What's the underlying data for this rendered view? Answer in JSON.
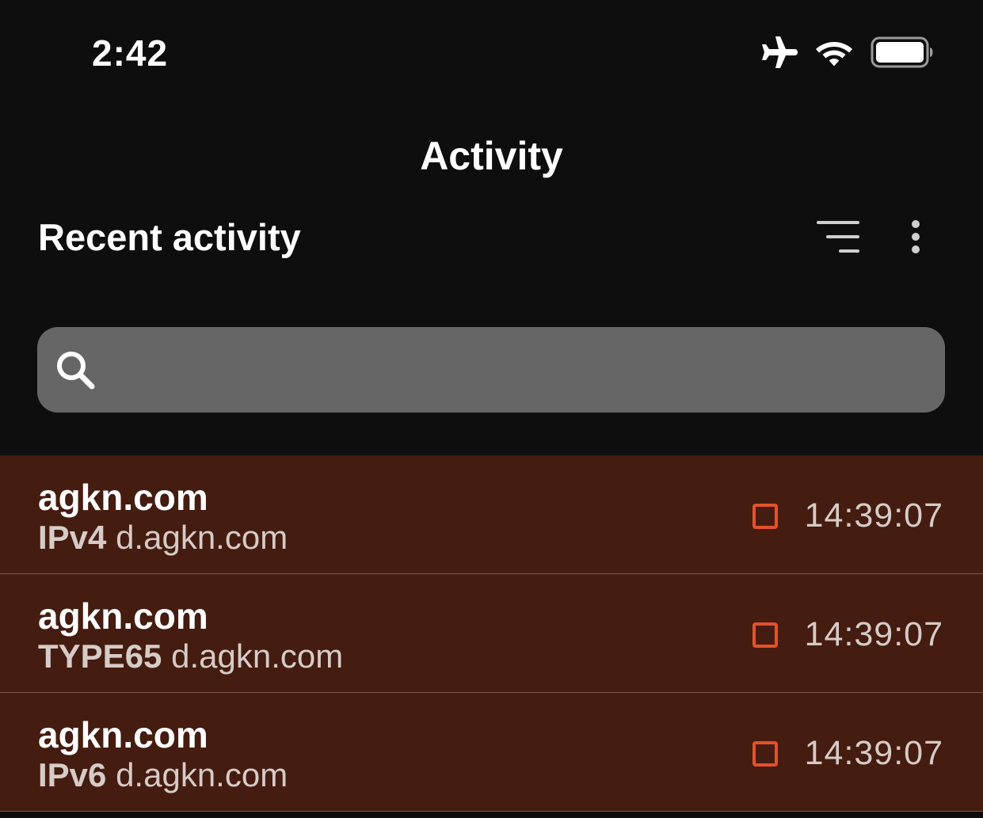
{
  "status_bar": {
    "time": "2:42",
    "icons": [
      "airplane-icon",
      "wifi-icon",
      "battery-icon"
    ]
  },
  "header": {
    "title": "Activity"
  },
  "section": {
    "title": "Recent activity",
    "filter_icon": "filter-icon",
    "more_icon": "more-vertical-icon"
  },
  "search": {
    "placeholder": "",
    "value": "",
    "icon": "search-icon"
  },
  "activity": {
    "rows": [
      {
        "domain": "agkn.com",
        "record_type": "IPv4",
        "subdomain": "d.agkn.com",
        "time": "14:39:07",
        "status_color": "#e4522a"
      },
      {
        "domain": "agkn.com",
        "record_type": "TYPE65",
        "subdomain": "d.agkn.com",
        "time": "14:39:07",
        "status_color": "#e4522a"
      },
      {
        "domain": "agkn.com",
        "record_type": "IPv6",
        "subdomain": "d.agkn.com",
        "time": "14:39:07",
        "status_color": "#e4522a"
      }
    ]
  },
  "colors": {
    "background": "#0e0e0e",
    "row_background": "#451c10",
    "search_background": "#666666",
    "accent": "#e4522a"
  }
}
